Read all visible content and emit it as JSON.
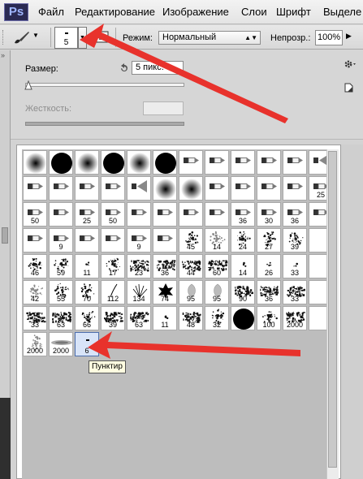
{
  "menubar": {
    "logo": "Ps",
    "items": [
      "Файл",
      "Редактирование",
      "Изображение",
      "Слои",
      "Шрифт",
      "Выделе"
    ]
  },
  "options": {
    "brush_size": "5",
    "mode_label": "Режим:",
    "mode_value": "Нормальный",
    "opacity_label": "Непрозр.:",
    "opacity_value": "100%"
  },
  "brush_panel": {
    "size_label": "Размер:",
    "size_value": "5 пикс.",
    "hardness_label": "Жесткость:",
    "size_slider_fraction": 0.0
  },
  "brush_presets": [
    {
      "shape": "soft-round",
      "size": ""
    },
    {
      "shape": "hard-round",
      "size": ""
    },
    {
      "shape": "soft-round",
      "size": ""
    },
    {
      "shape": "hard-round",
      "size": ""
    },
    {
      "shape": "soft-round",
      "size": ""
    },
    {
      "shape": "hard-round",
      "size": ""
    },
    {
      "shape": "tool-round",
      "size": ""
    },
    {
      "shape": "tool-pencil",
      "size": ""
    },
    {
      "shape": "tool-pencil",
      "size": ""
    },
    {
      "shape": "tool-pencil",
      "size": ""
    },
    {
      "shape": "tool-pencil",
      "size": ""
    },
    {
      "shape": "tool-fan",
      "size": ""
    },
    {
      "shape": "tool-pencil",
      "size": ""
    },
    {
      "shape": "tool-pencil",
      "size": ""
    },
    {
      "shape": "tool-angle",
      "size": ""
    },
    {
      "shape": "tool-angle",
      "size": ""
    },
    {
      "shape": "tool-fan",
      "size": ""
    },
    {
      "shape": "soft-round",
      "size": ""
    },
    {
      "shape": "soft-round",
      "size": ""
    },
    {
      "shape": "tool-pencil",
      "size": ""
    },
    {
      "shape": "tool-angle",
      "size": ""
    },
    {
      "shape": "tool-angle",
      "size": ""
    },
    {
      "shape": "tool-pencil",
      "size": ""
    },
    {
      "shape": "tool-pencil",
      "size": "25"
    },
    {
      "shape": "tool-pencil",
      "size": "50"
    },
    {
      "shape": "tool-round",
      "size": ""
    },
    {
      "shape": "tool-round",
      "size": "25"
    },
    {
      "shape": "tool-round",
      "size": "50"
    },
    {
      "shape": "tool-round",
      "size": ""
    },
    {
      "shape": "tool-round",
      "size": ""
    },
    {
      "shape": "tool-round",
      "size": ""
    },
    {
      "shape": "tool-round",
      "size": ""
    },
    {
      "shape": "tool-pencil",
      "size": "36"
    },
    {
      "shape": "tool-pencil",
      "size": "30"
    },
    {
      "shape": "tool-pencil",
      "size": "36"
    },
    {
      "shape": "tool-pencil",
      "size": ""
    },
    {
      "shape": "tool-pencil",
      "size": ""
    },
    {
      "shape": "tool-pencil",
      "size": "9"
    },
    {
      "shape": "tool-pencil",
      "size": ""
    },
    {
      "shape": "tool-pencil",
      "size": ""
    },
    {
      "shape": "tool-pencil",
      "size": "9"
    },
    {
      "shape": "tool-pencil",
      "size": ""
    },
    {
      "shape": "scatter",
      "size": "45"
    },
    {
      "shape": "scatter-light",
      "size": "14"
    },
    {
      "shape": "scatter",
      "size": "24"
    },
    {
      "shape": "scatter",
      "size": "27"
    },
    {
      "shape": "scatter",
      "size": "39"
    },
    {
      "shape": "",
      "size": ""
    },
    {
      "shape": "scatter",
      "size": "46"
    },
    {
      "shape": "scatter",
      "size": "59"
    },
    {
      "shape": "dot",
      "size": "11"
    },
    {
      "shape": "scatter",
      "size": "17"
    },
    {
      "shape": "texture",
      "size": "23"
    },
    {
      "shape": "texture",
      "size": "36"
    },
    {
      "shape": "texture",
      "size": "44"
    },
    {
      "shape": "texture",
      "size": "60"
    },
    {
      "shape": "dot",
      "size": "14"
    },
    {
      "shape": "dot",
      "size": "26"
    },
    {
      "shape": "dot",
      "size": "33"
    },
    {
      "shape": "",
      "size": ""
    },
    {
      "shape": "scatter-light",
      "size": "42"
    },
    {
      "shape": "scatter",
      "size": "55"
    },
    {
      "shape": "scatter",
      "size": "70"
    },
    {
      "shape": "line",
      "size": "112"
    },
    {
      "shape": "grass",
      "size": "134"
    },
    {
      "shape": "leaf",
      "size": "74"
    },
    {
      "shape": "leaf-grey",
      "size": "95"
    },
    {
      "shape": "leaf-grey",
      "size": "95"
    },
    {
      "shape": "texture",
      "size": "90"
    },
    {
      "shape": "texture",
      "size": "36"
    },
    {
      "shape": "texture",
      "size": "33"
    },
    {
      "shape": "",
      "size": ""
    },
    {
      "shape": "texture",
      "size": "33"
    },
    {
      "shape": "texture",
      "size": "63"
    },
    {
      "shape": "scatter",
      "size": "66"
    },
    {
      "shape": "texture",
      "size": "39"
    },
    {
      "shape": "texture",
      "size": "63"
    },
    {
      "shape": "dot",
      "size": "11"
    },
    {
      "shape": "texture",
      "size": "48"
    },
    {
      "shape": "scatter",
      "size": "32"
    },
    {
      "shape": "hard-round",
      "size": "55"
    },
    {
      "shape": "scatter",
      "size": "100"
    },
    {
      "shape": "texture",
      "size": "2000"
    },
    {
      "shape": "",
      "size": ""
    },
    {
      "shape": "scatter-light",
      "size": "2000"
    },
    {
      "shape": "smudge",
      "size": "2000"
    },
    {
      "shape": "dash",
      "size": "6"
    }
  ],
  "tooltip": "Пунктир"
}
